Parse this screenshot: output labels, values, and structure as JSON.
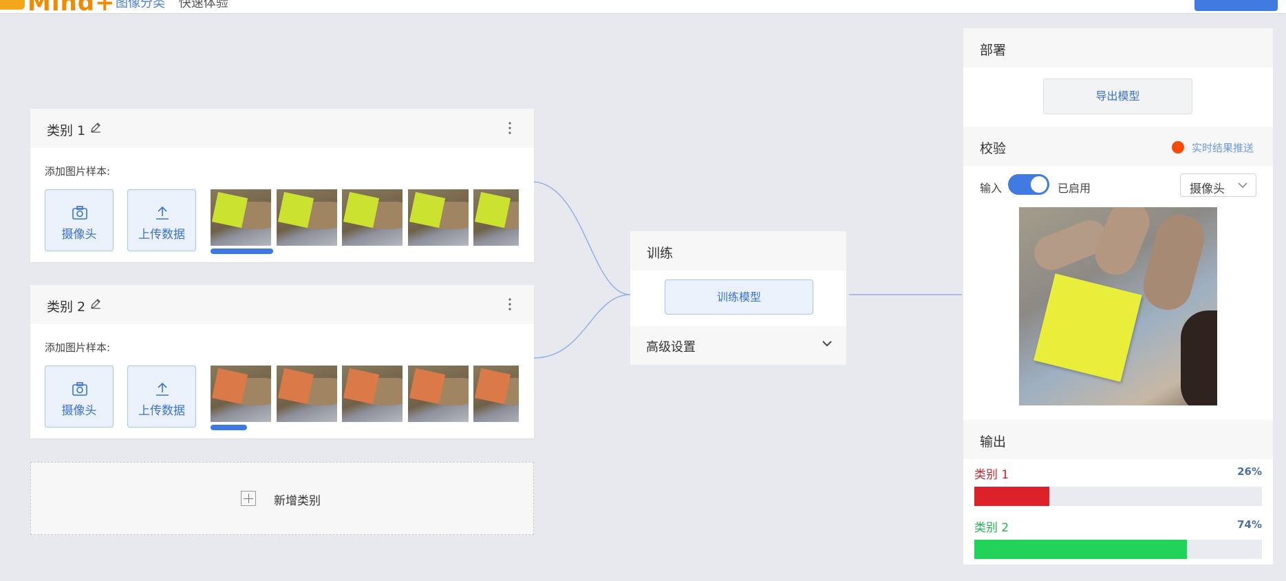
{
  "header": {
    "logo": "Mind+",
    "breadcrumb": [
      "图像分类",
      "快速体验"
    ],
    "nav": [
      "",
      "",
      "",
      ""
    ],
    "primary_button": ""
  },
  "categories": [
    {
      "name": "类别 1",
      "sample_label": "添加图片样本:",
      "camera_label": "摄像头",
      "upload_label": "上传数据",
      "sample_color": "#cbe230",
      "progress_pct": 100
    },
    {
      "name": "类别 2",
      "sample_label": "添加图片样本:",
      "camera_label": "摄像头",
      "upload_label": "上传数据",
      "sample_color": "#d97a48",
      "progress_pct": 58
    }
  ],
  "add_category": {
    "label": "新增类别"
  },
  "train": {
    "title": "训练",
    "button": "训练模型",
    "advanced": "高级设置"
  },
  "deploy": {
    "title": "部署",
    "export_button": "导出模型"
  },
  "verify": {
    "title": "校验",
    "live_label": "实时结果推送",
    "live_dot_color": "#fa4a0a",
    "input_label": "输入",
    "toggle_state_label": "已启用",
    "source_select": "摄像头"
  },
  "output": {
    "title": "输出",
    "results": [
      {
        "name": "类别 1",
        "percent_label": "26%",
        "percent": 26,
        "color": "#dc2228",
        "label_color": "#c8262c"
      },
      {
        "name": "类别 2",
        "percent_label": "74%",
        "percent": 74,
        "color": "#22d35a",
        "label_color": "#23b24f"
      }
    ]
  }
}
